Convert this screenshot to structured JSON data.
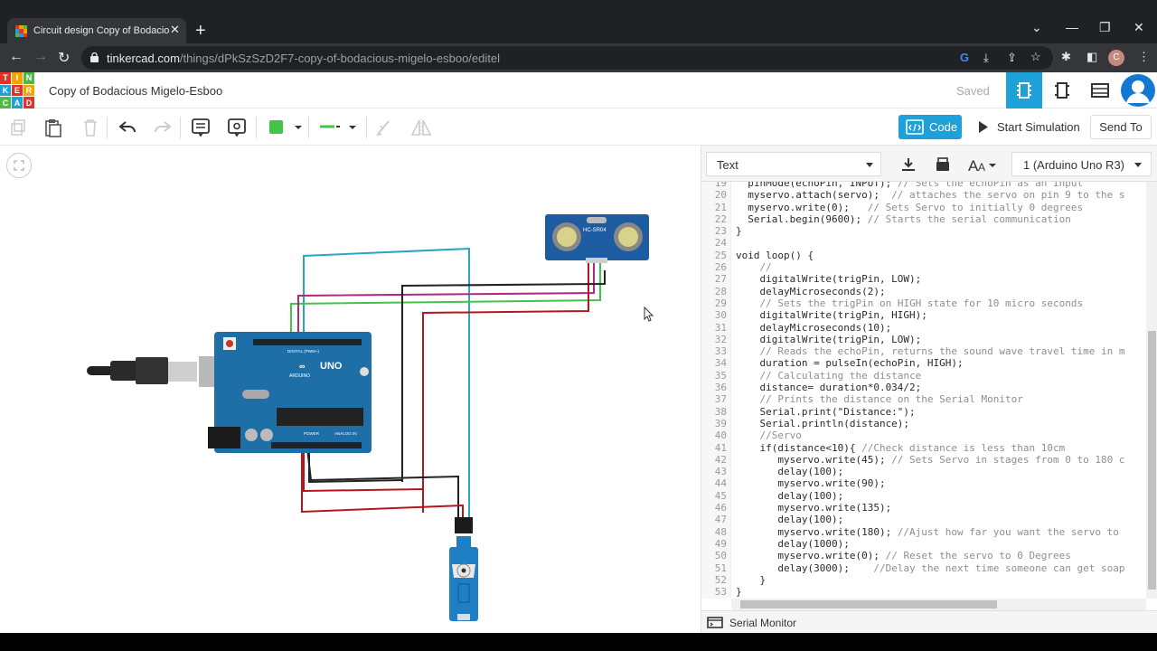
{
  "browser": {
    "tab_title": "Circuit design Copy of Bodacious",
    "url_host": "tinkercad.com",
    "url_path": "/things/dPkSzSzD2F7-copy-of-bodacious-migelo-esboo/editel",
    "profile_initial": "C"
  },
  "app": {
    "logo_letters": [
      "T",
      "I",
      "N",
      "K",
      "E",
      "R",
      "C",
      "A",
      "D"
    ],
    "project_title": "Copy of Bodacious Migelo-Esboo",
    "status": "Saved"
  },
  "toolbar": {
    "code_label": "Code",
    "simulate_label": "Start Simulation",
    "send_label": "Send To"
  },
  "code_panel": {
    "mode": "Text",
    "device": "1 (Arduino Uno R3)",
    "lines": [
      {
        "n": "20",
        "code": "  myservo.attach(servo);  ",
        "comment": "// attaches the servo on pin 9 to the s"
      },
      {
        "n": "21",
        "code": "  myservo.write(0);   ",
        "comment": "// Sets Servo to initially 0 degrees"
      },
      {
        "n": "22",
        "code": "  Serial.begin(9600); ",
        "comment": "// Starts the serial communication"
      },
      {
        "n": "23",
        "code": "}",
        "comment": ""
      },
      {
        "n": "24",
        "code": "",
        "comment": ""
      },
      {
        "n": "25",
        "code": "void loop() {",
        "comment": ""
      },
      {
        "n": "26",
        "code": "    ",
        "comment": "//"
      },
      {
        "n": "27",
        "code": "    digitalWrite(trigPin, LOW);",
        "comment": ""
      },
      {
        "n": "28",
        "code": "    delayMicroseconds(2);",
        "comment": ""
      },
      {
        "n": "29",
        "code": "    ",
        "comment": "// Sets the trigPin on HIGH state for 10 micro seconds"
      },
      {
        "n": "30",
        "code": "    digitalWrite(trigPin, HIGH);",
        "comment": ""
      },
      {
        "n": "31",
        "code": "    delayMicroseconds(10);",
        "comment": ""
      },
      {
        "n": "32",
        "code": "    digitalWrite(trigPin, LOW);",
        "comment": ""
      },
      {
        "n": "33",
        "code": "    ",
        "comment": "// Reads the echoPin, returns the sound wave travel time in m"
      },
      {
        "n": "34",
        "code": "    duration = pulseIn(echoPin, HIGH);",
        "comment": ""
      },
      {
        "n": "35",
        "code": "    ",
        "comment": "// Calculating the distance"
      },
      {
        "n": "36",
        "code": "    distance= duration*0.034/2;",
        "comment": ""
      },
      {
        "n": "37",
        "code": "    ",
        "comment": "// Prints the distance on the Serial Monitor"
      },
      {
        "n": "38",
        "code": "    Serial.print(\"Distance:\");",
        "comment": ""
      },
      {
        "n": "39",
        "code": "    Serial.println(distance);",
        "comment": ""
      },
      {
        "n": "40",
        "code": "    ",
        "comment": "//Servo"
      },
      {
        "n": "41",
        "code": "    if(distance<10){ ",
        "comment": "//Check distance is less than 10cm"
      },
      {
        "n": "42",
        "code": "       myservo.write(45); ",
        "comment": "// Sets Servo in stages from 0 to 180 c"
      },
      {
        "n": "43",
        "code": "       delay(100);",
        "comment": ""
      },
      {
        "n": "44",
        "code": "       myservo.write(90);",
        "comment": ""
      },
      {
        "n": "45",
        "code": "       delay(100);",
        "comment": ""
      },
      {
        "n": "46",
        "code": "       myservo.write(135);",
        "comment": ""
      },
      {
        "n": "47",
        "code": "       delay(100);",
        "comment": ""
      },
      {
        "n": "48",
        "code": "       myservo.write(180); ",
        "comment": "//Ajust how far you want the servo to"
      },
      {
        "n": "49",
        "code": "       delay(1000);",
        "comment": ""
      },
      {
        "n": "50",
        "code": "       myservo.write(0); ",
        "comment": "// Reset the servo to 0 Degrees"
      },
      {
        "n": "51",
        "code": "       delay(3000);    ",
        "comment": "//Delay the next time someone can get soap"
      },
      {
        "n": "52",
        "code": "    }",
        "comment": ""
      },
      {
        "n": "53",
        "code": "}",
        "comment": ""
      }
    ],
    "serial_monitor_label": "Serial Monitor"
  },
  "circuit": {
    "arduino_brand": "ARDUINO",
    "arduino_model": "UNO",
    "arduino_digital_label": "DIGITAL (PWM~)",
    "arduino_power_label": "POWER",
    "arduino_analog_label": "ANALOG IN",
    "sensor_label": "HC-SR04"
  },
  "colors": {
    "accent": "#1da1d8",
    "wire_cyan": "#29a6c2",
    "wire_green": "#44c24a",
    "wire_magenta": "#b0277f",
    "wire_red": "#b5161e",
    "wire_black": "#222222",
    "arduino_board": "#1e6fa8",
    "servo_body": "#1f7fc4",
    "sensor_body": "#1e5ca2"
  }
}
